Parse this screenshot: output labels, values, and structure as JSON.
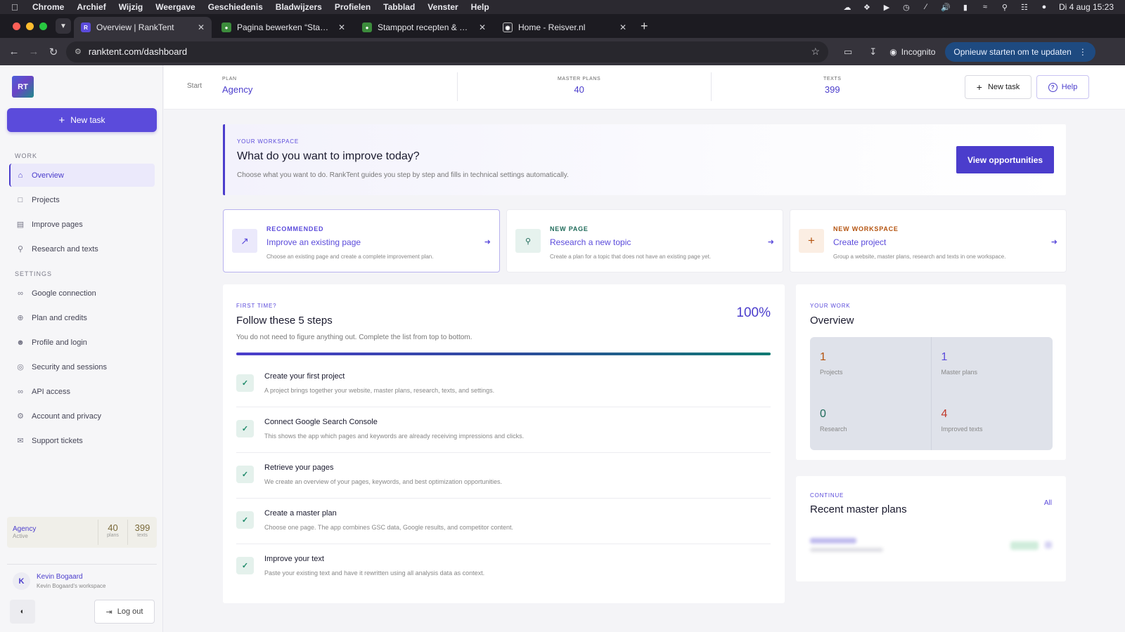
{
  "menubar": {
    "app": "Chrome",
    "items": [
      "Archief",
      "Wijzig",
      "Weergave",
      "Geschiedenis",
      "Bladwijzers",
      "Profielen",
      "Tabblad",
      "Venster",
      "Help"
    ],
    "clock": "Di 4 aug  15:23"
  },
  "browser": {
    "tabs": [
      {
        "title": "Overview | RankTent",
        "active": true
      },
      {
        "title": "Pagina bewerken “Stamppot recepten & meer!”",
        "active": false
      },
      {
        "title": "Stamppot recepten & meer! | Reisver.nl",
        "active": false
      },
      {
        "title": "Home - Reisver.nl",
        "active": false
      }
    ],
    "url": "ranktent.com/dashboard",
    "incognito_label": "Incognito",
    "update_label": "Opnieuw starten om te updaten"
  },
  "sidebar": {
    "logo_text": "RT",
    "new_task_label": "New task",
    "work_heading": "WORK",
    "work_items": [
      {
        "label": "Overview",
        "icon": "home-icon",
        "active": true
      },
      {
        "label": "Projects",
        "icon": "folder-icon"
      },
      {
        "label": "Improve pages",
        "icon": "document-icon"
      },
      {
        "label": "Research and texts",
        "icon": "search-icon"
      }
    ],
    "settings_heading": "SETTINGS",
    "settings_items": [
      {
        "label": "Google connection",
        "icon": "link-icon"
      },
      {
        "label": "Plan and credits",
        "icon": "plus-circle-icon"
      },
      {
        "label": "Profile and login",
        "icon": "user-icon"
      },
      {
        "label": "Security and sessions",
        "icon": "shield-icon"
      },
      {
        "label": "API access",
        "icon": "link-icon"
      },
      {
        "label": "Account and privacy",
        "icon": "settings-icon"
      },
      {
        "label": "Support tickets",
        "icon": "chat-icon"
      }
    ],
    "plan": {
      "name": "Agency",
      "status": "Active",
      "plans": "40",
      "plans_label": "plans",
      "texts": "399",
      "texts_label": "texts"
    },
    "user": {
      "initial": "K",
      "name": "Kevin Bogaard",
      "workspace": "Kevin Bogaard's workspace"
    },
    "logout_label": "Log out"
  },
  "topbar": {
    "crumb": "Start",
    "plan_label": "PLAN",
    "plan_value": "Agency",
    "master_plans_label": "MASTER PLANS",
    "master_plans_value": "40",
    "texts_label": "TEXTS",
    "texts_value": "399",
    "new_task_label": "New task",
    "help_label": "Help"
  },
  "hero": {
    "eyebrow": "YOUR WORKSPACE",
    "title": "What do you want to improve today?",
    "description": "Choose what you want to do. RankTent guides you step by step and fills in technical settings automatically.",
    "button": "View opportunities"
  },
  "actions": [
    {
      "eyebrow": "RECOMMENDED",
      "title": "Improve an existing page",
      "description": "Choose an existing page and create a complete improvement plan.",
      "icon": "arrow-up-right-icon",
      "color": "#5b4bdb"
    },
    {
      "eyebrow": "NEW PAGE",
      "title": "Research a new topic",
      "description": "Create a plan for a topic that does not have an existing page yet.",
      "icon": "search-icon",
      "color": "#1f6b5a"
    },
    {
      "eyebrow": "NEW WORKSPACE",
      "title": "Create project",
      "description": "Group a website, master plans, research and texts in one workspace.",
      "icon": "plus-icon",
      "color": "#b4530f"
    }
  ],
  "steps": {
    "eyebrow": "FIRST TIME?",
    "title": "Follow these 5 steps",
    "description": "You do not need to figure anything out. Complete the list from top to bottom.",
    "percent_text": "100%",
    "progress": 1.0,
    "items": [
      {
        "title": "Create your first project",
        "description": "A project brings together your website, master plans, research, texts, and settings."
      },
      {
        "title": "Connect Google Search Console",
        "description": "This shows the app which pages and keywords are already receiving impressions and clicks."
      },
      {
        "title": "Retrieve your pages",
        "description": "We create an overview of your pages, keywords, and best optimization opportunities."
      },
      {
        "title": "Create a master plan",
        "description": "Choose one page. The app combines GSC data, Google results, and competitor content."
      },
      {
        "title": "Improve your text",
        "description": "Paste your existing text and have it rewritten using all analysis data as context."
      }
    ]
  },
  "overview": {
    "eyebrow": "YOUR WORK",
    "title": "Overview",
    "stats": [
      {
        "value": "1",
        "label": "Projects",
        "color": "#b4530f"
      },
      {
        "value": "1",
        "label": "Master plans",
        "color": "#5b4bdb"
      },
      {
        "value": "0",
        "label": "Research",
        "color": "#1f6b5a"
      },
      {
        "value": "4",
        "label": "Improved texts",
        "color": "#c0392b"
      }
    ]
  },
  "recent": {
    "eyebrow": "CONTINUE",
    "title": "Recent master plans",
    "all_label": "All"
  }
}
